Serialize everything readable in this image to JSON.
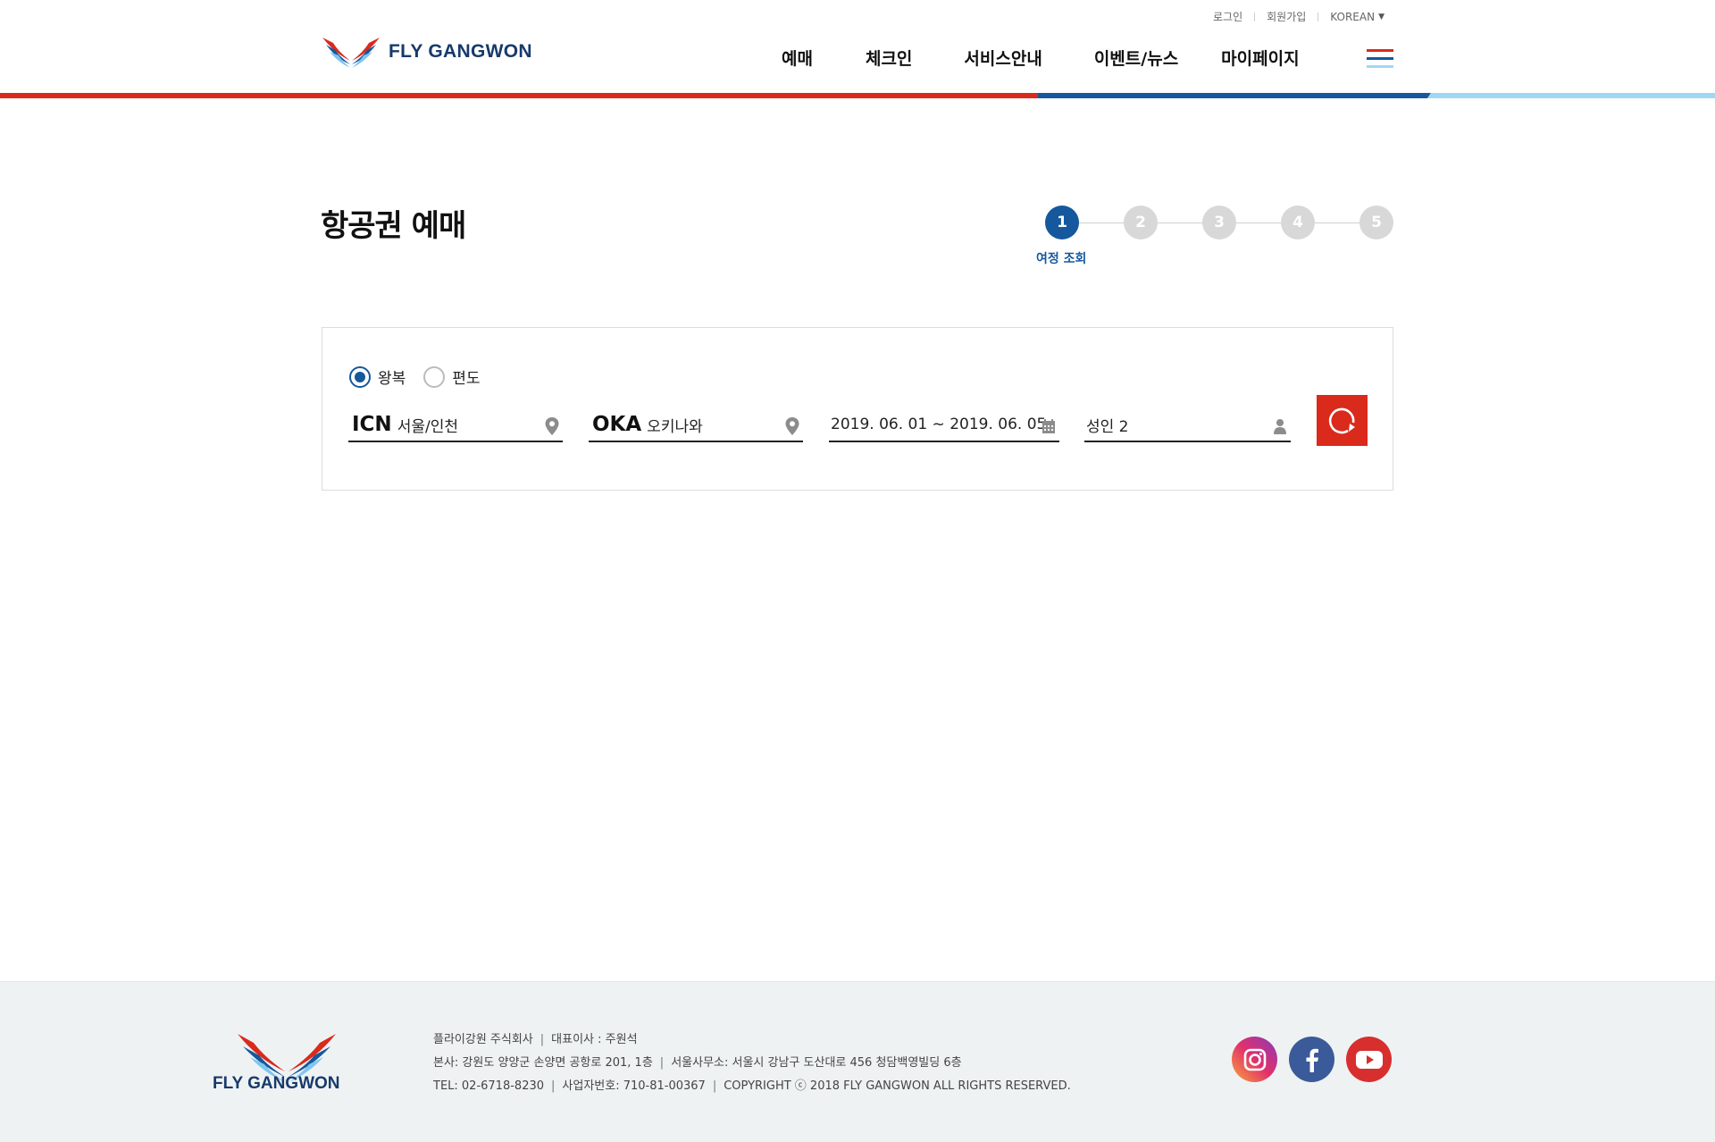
{
  "header": {
    "utility": {
      "login": "로그인",
      "signup": "회원가입",
      "language": "KOREAN"
    },
    "logo_text": "FLY GANGWON",
    "nav": [
      "예매",
      "체크인",
      "서비스안내",
      "이벤트/뉴스",
      "마이페이지"
    ],
    "colors": {
      "red": "#d92a1c",
      "blue": "#15589d",
      "light_blue": "#9fd8f5"
    }
  },
  "page": {
    "title": "항공권 예매",
    "steps": [
      "1",
      "2",
      "3",
      "4",
      "5"
    ],
    "active_step": 1,
    "active_step_label": "여정 조회"
  },
  "search": {
    "trip_types": {
      "roundtrip": "왕복",
      "oneway": "편도"
    },
    "selected_trip": "왕복",
    "origin": {
      "code": "ICN",
      "name": "서울/인천"
    },
    "destination": {
      "code": "OKA",
      "name": "오키나와"
    },
    "dates": "2019. 06. 01 ~ 2019. 06. 05",
    "passengers": "성인 2",
    "icons": {
      "origin": "location-pin-icon",
      "destination": "location-pin-icon",
      "dates": "calendar-icon",
      "passengers": "person-icon",
      "search": "refresh-search-icon"
    }
  },
  "footer": {
    "logo_text": "FLY GANGWON",
    "company": "플라이강원 주식회사",
    "ceo": "대표이사 : 주원석",
    "hq": "본사: 강원도 양양군 손양면 공항로 201, 1층",
    "seoul_office": "서울사무소: 서울시 강남구 도산대로 456 청담백영빌딩 6층",
    "tel": "TEL: 02-6718-8230",
    "biz_no": "사업자번호: 710-81-00367",
    "copyright": "COPYRIGHT ⓒ 2018 FLY GANGWON ALL RIGHTS RESERVED.",
    "social": [
      "instagram-icon",
      "facebook-icon",
      "youtube-icon"
    ]
  }
}
